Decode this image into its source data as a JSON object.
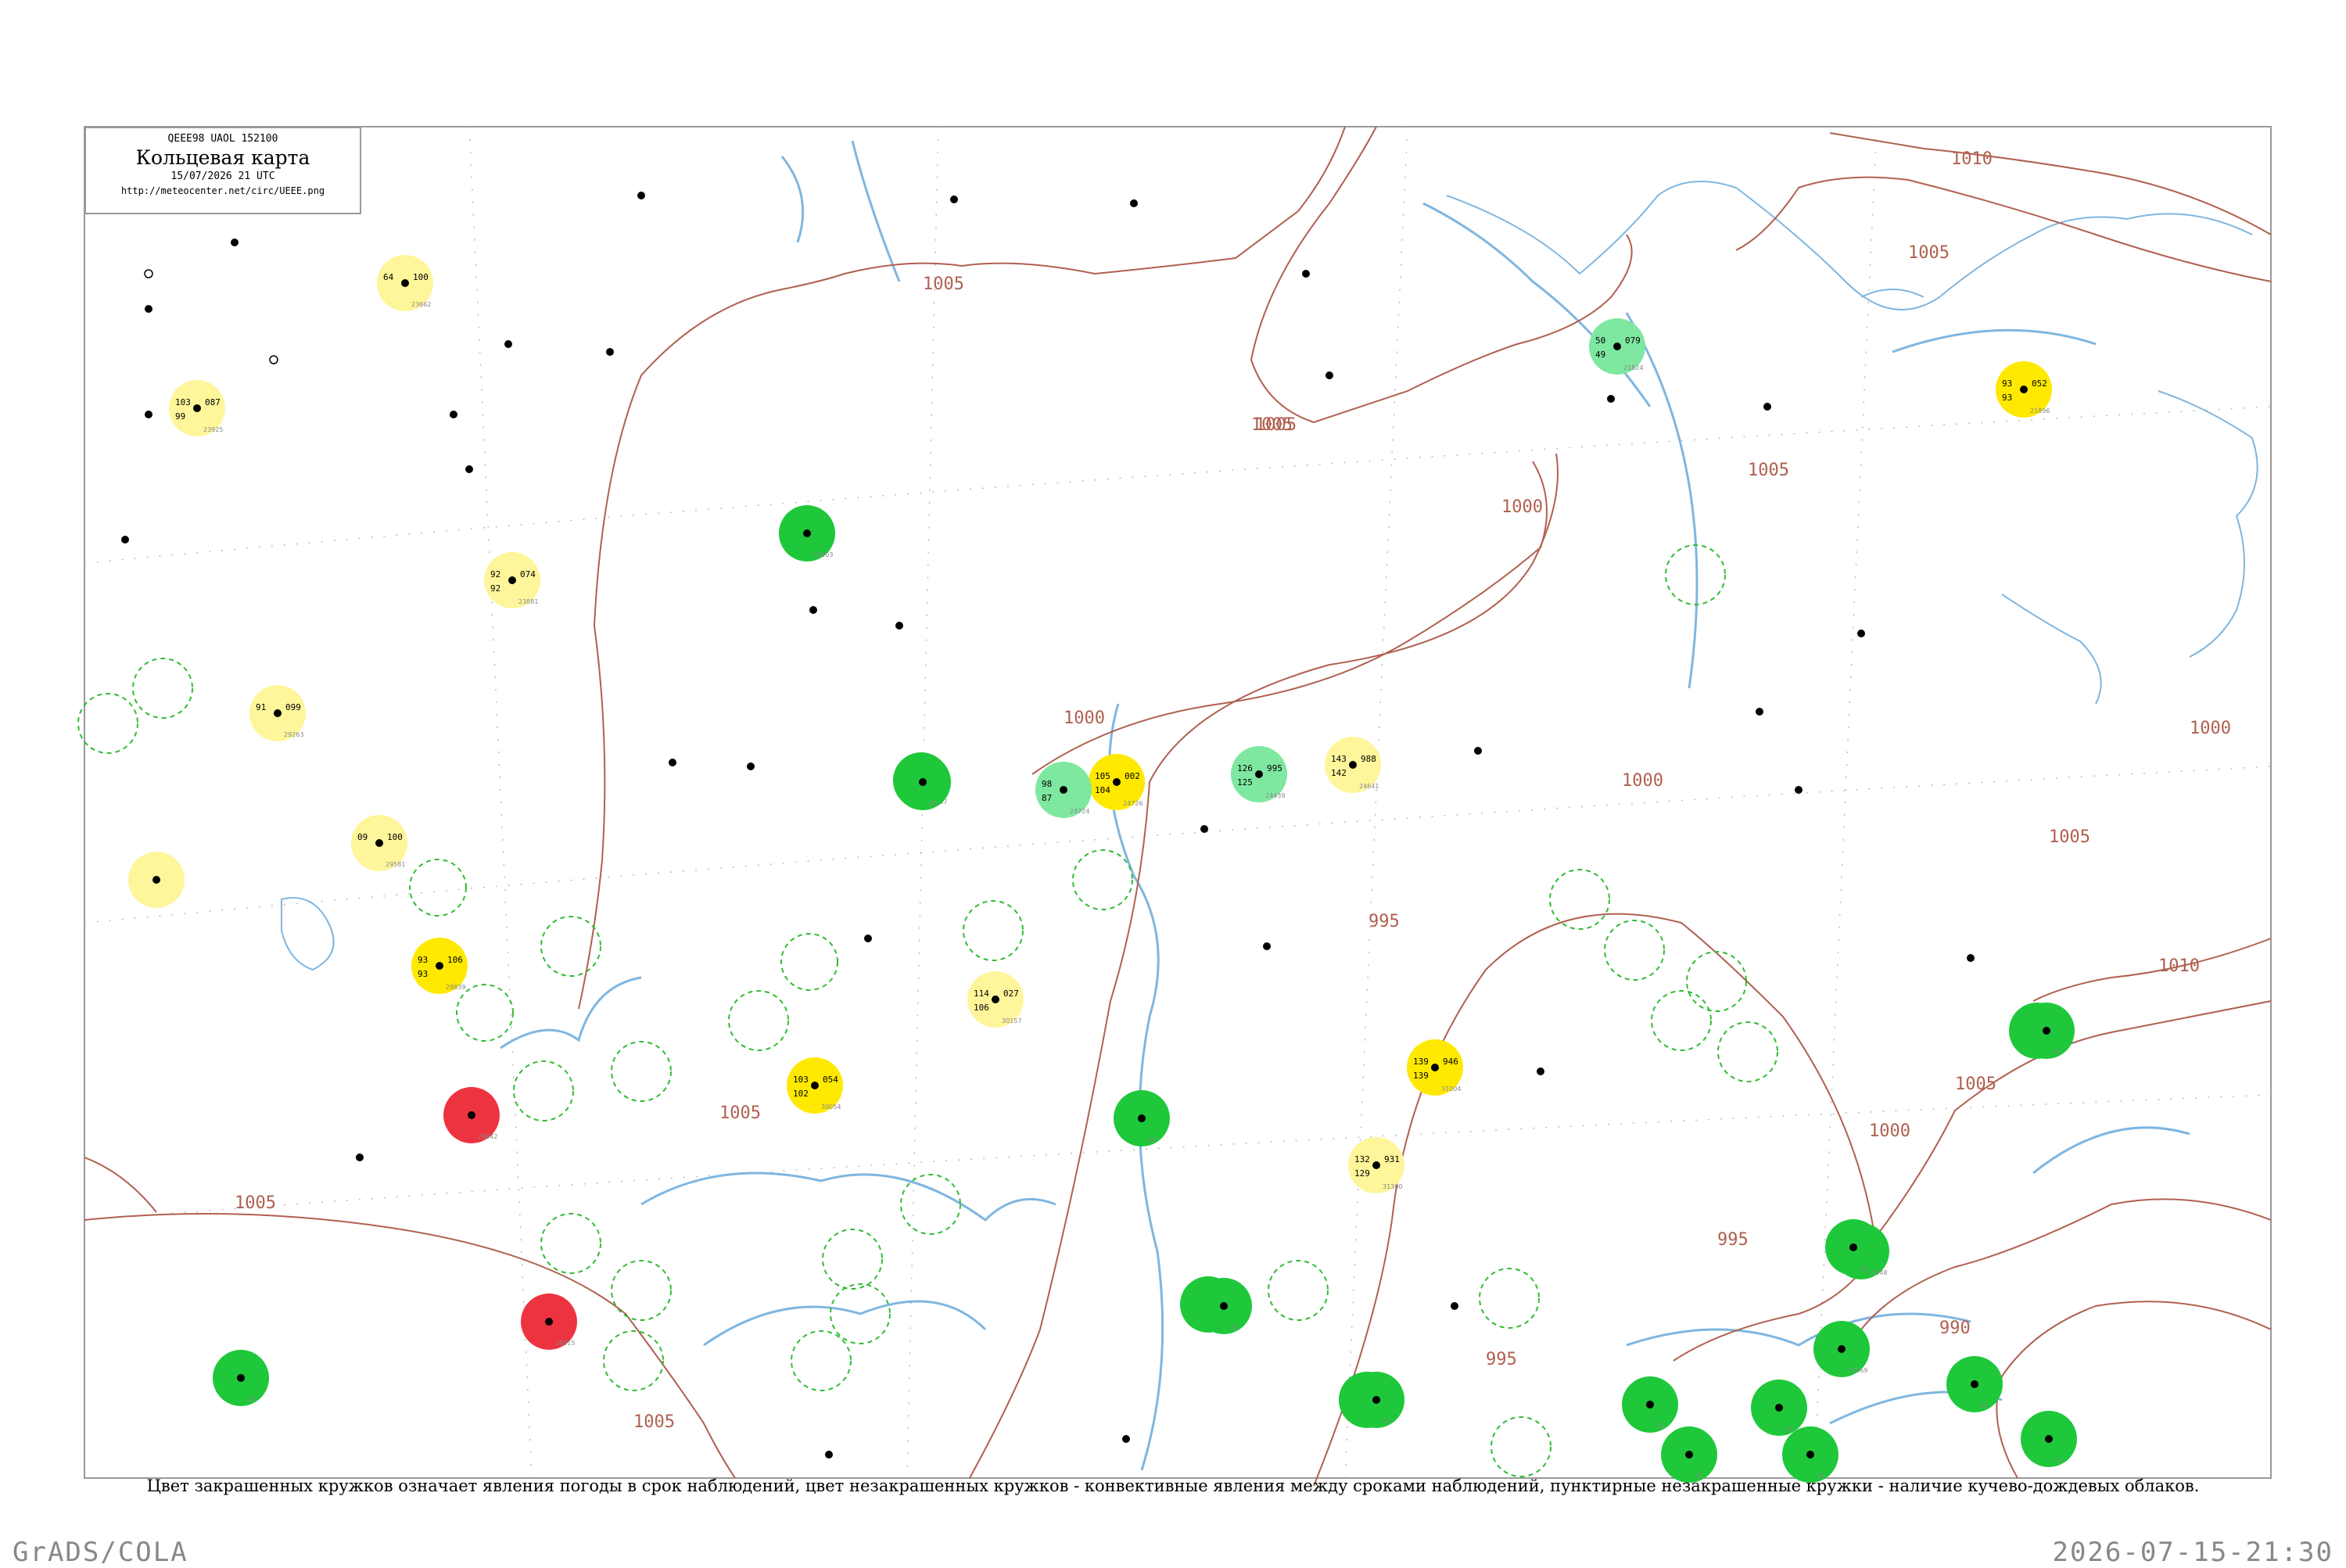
{
  "header": {
    "codes": "QEEE98  UAOL  152100",
    "title": "Кольцевая карта",
    "time": "15/07/2026 21 UTC",
    "url": "http://meteocenter.net/circ/UEEE.png"
  },
  "legend_text": "Цвет закрашенных кружков означает явления погоды в срок наблюдений, цвет незакрашенных кружков - конвективные явления между сроками наблюдений, пунктирные незакрашенные кружки - наличие кучево-дождевых облаков.",
  "footer": {
    "software": "GrADS/COLA",
    "datetime": "2026-07-15-21:30"
  },
  "colors": {
    "isobar": "#b06050",
    "river": "#7fb6e0",
    "frame": "#999999",
    "green": "#1ec83a",
    "light_green": "#7ee8a0",
    "yellow": "#ffe900",
    "light_yellow": "#fff59a",
    "red": "#ee3340",
    "light_red": "#f4a0a0",
    "dashed_circle": "#33bb33"
  },
  "isobar_labels": [
    "1005",
    "1005",
    "1005",
    "1000",
    "1000",
    "1000",
    "995",
    "995",
    "990",
    "1000",
    "1005",
    "1010",
    "1005",
    "1005",
    "1010",
    "1005",
    "1000",
    "1005",
    "1005",
    "1005",
    "995"
  ],
  "stations": [
    {
      "pressure": "100",
      "temp": "64",
      "dew": "",
      "index": "23662",
      "fill": "light_yellow"
    },
    {
      "pressure": "087",
      "temp": "103",
      "dew": "99",
      "index": "23925",
      "fill": "light_yellow"
    },
    {
      "pressure": "074",
      "temp": "92",
      "dew": "92",
      "index": "23881",
      "fill": "light_yellow"
    },
    {
      "pressure": "099",
      "temp": "91",
      "dew": "",
      "index": "29263",
      "fill": "light_yellow"
    },
    {
      "pressure": "100",
      "temp": "09",
      "dew": "",
      "index": "29581",
      "fill": "light_yellow"
    },
    {
      "pressure": "",
      "temp": "",
      "dew": "",
      "index": "",
      "fill": "light_yellow"
    },
    {
      "pressure": "106",
      "temp": "93",
      "dew": "93",
      "index": "29839",
      "fill": "yellow"
    },
    {
      "pressure": "",
      "temp": "",
      "dew": "",
      "index": "29842",
      "fill": "red"
    },
    {
      "pressure": "",
      "temp": "",
      "dew": "",
      "index": "29915",
      "fill": "red"
    },
    {
      "pressure": "",
      "temp": "",
      "dew": "",
      "index": "24503",
      "fill": "green"
    },
    {
      "pressure": "",
      "temp": "",
      "dew": "",
      "index": "24507",
      "fill": "green"
    },
    {
      "pressure": "002",
      "temp": "105",
      "dew": "104",
      "index": "24726",
      "fill": "yellow"
    },
    {
      "pressure": "",
      "temp": "98",
      "dew": "87",
      "index": "24724",
      "fill": "light_green"
    },
    {
      "pressure": "995",
      "temp": "126",
      "dew": "125",
      "index": "24439",
      "fill": "light_green"
    },
    {
      "pressure": "988",
      "temp": "143",
      "dew": "142",
      "index": "24641",
      "fill": "light_yellow"
    },
    {
      "pressure": "079",
      "temp": "50",
      "dew": "49",
      "index": "21824",
      "fill": "light_green"
    },
    {
      "pressure": "052",
      "temp": "93",
      "dew": "93",
      "index": "21896",
      "fill": "yellow"
    },
    {
      "pressure": "027",
      "temp": "114",
      "dew": "106",
      "index": "30157",
      "fill": "light_yellow"
    },
    {
      "pressure": "054",
      "temp": "103",
      "dew": "102",
      "index": "30054",
      "fill": "yellow"
    },
    {
      "pressure": "",
      "temp": "",
      "dew": "",
      "index": "30",
      "fill": "green"
    },
    {
      "pressure": "946",
      "temp": "139",
      "dew": "139",
      "index": "31004",
      "fill": "yellow"
    },
    {
      "pressure": "931",
      "temp": "132",
      "dew": "129",
      "index": "31300",
      "fill": "light_yellow"
    },
    {
      "pressure": "",
      "temp": "",
      "dew": "",
      "index": "31088",
      "fill": "green"
    },
    {
      "pressure": "",
      "temp": "",
      "dew": "",
      "index": "25",
      "fill": "green"
    },
    {
      "pressure": "",
      "temp": "",
      "dew": "",
      "index": "31348",
      "fill": "green"
    },
    {
      "pressure": "",
      "temp": "",
      "dew": "",
      "index": "31369",
      "fill": "green"
    },
    {
      "pressure": "",
      "temp": "",
      "dew": "",
      "index": "30",
      "fill": "green"
    },
    {
      "pressure": "",
      "temp": "",
      "dew": "",
      "index": "30",
      "fill": "green"
    },
    {
      "pressure": "",
      "temp": "",
      "dew": "",
      "index": "31",
      "fill": "green"
    },
    {
      "pressure": "",
      "temp": "",
      "dew": "",
      "index": "31",
      "fill": "green"
    },
    {
      "pressure": "",
      "temp": "",
      "dew": "",
      "index": "32",
      "fill": "green"
    },
    {
      "pressure": "",
      "temp": "",
      "dew": "",
      "index": "32",
      "fill": "green"
    },
    {
      "pressure": "",
      "temp": "",
      "dew": "",
      "index": "31",
      "fill": "green"
    },
    {
      "pressure": "",
      "temp": "",
      "dew": "",
      "index": "31",
      "fill": "green"
    },
    {
      "pressure": "",
      "temp": "",
      "dew": "",
      "index": "32",
      "fill": "green"
    },
    {
      "pressure": "",
      "temp": "",
      "dew": "",
      "index": "32",
      "fill": "green"
    },
    {
      "pressure": "",
      "temp": "",
      "dew": "",
      "index": "32",
      "fill": "green"
    },
    {
      "pressure": "",
      "temp": "",
      "dew": "",
      "index": "32",
      "fill": "green"
    },
    {
      "pressure": "",
      "temp": "",
      "dew": "",
      "index": "29",
      "fill": "green"
    }
  ]
}
